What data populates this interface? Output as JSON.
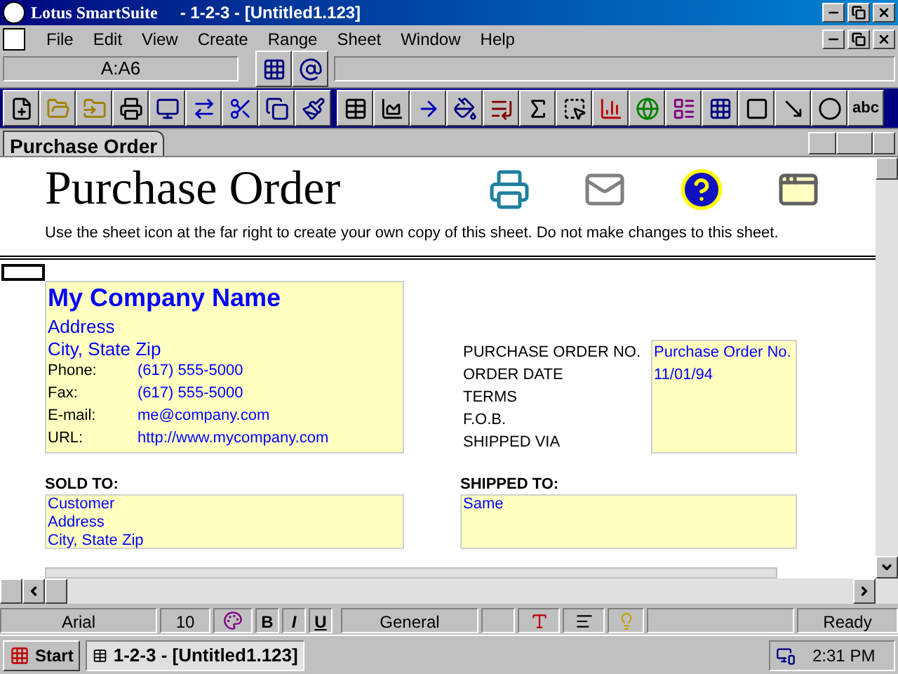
{
  "window": {
    "app": "Lotus SmartSuite",
    "title": "-  1-2-3 - [Untitled1.123]"
  },
  "menu": [
    "File",
    "Edit",
    "View",
    "Create",
    "Range",
    "Sheet",
    "Window",
    "Help"
  ],
  "formula_bar": {
    "cell_address": "A:A6"
  },
  "toolbar": {
    "text_tool": "abc"
  },
  "sheet_tabs": [
    {
      "label": "Purchase Order",
      "selected": true
    }
  ],
  "sheet": {
    "title": "Purchase Order",
    "instruction": "Use the sheet icon at the far right to create your own copy of this sheet.  Do not make changes to this sheet.",
    "company": {
      "name": "My Company Name",
      "address": "Address",
      "city": "City, State Zip",
      "fields": [
        {
          "label": "Phone:",
          "value": "(617) 555-5000"
        },
        {
          "label": "Fax:",
          "value": "(617) 555-5000"
        },
        {
          "label": "E-mail:",
          "value": "me@company.com"
        },
        {
          "label": "URL:",
          "value": "http://www.mycompany.com"
        }
      ]
    },
    "order_fields": {
      "labels": [
        "PURCHASE ORDER NO.",
        "ORDER DATE",
        "TERMS",
        "F.O.B.",
        "SHIPPED VIA"
      ],
      "values": [
        "Purchase Order No.",
        "11/01/94"
      ]
    },
    "sold_to": {
      "heading": "SOLD TO:",
      "lines": [
        "Customer",
        "Address",
        "City, State Zip"
      ]
    },
    "shipped_to": {
      "heading": "SHIPPED TO:",
      "lines": [
        "Same"
      ]
    }
  },
  "status_bar": {
    "font": "Arial",
    "size": "10",
    "style_buttons": [
      "B",
      "I",
      "U"
    ],
    "format": "General",
    "mode": "Ready"
  },
  "taskbar": {
    "start": "Start",
    "task": "1-2-3 - [Untitled1.123]",
    "clock": "2:31 PM"
  }
}
